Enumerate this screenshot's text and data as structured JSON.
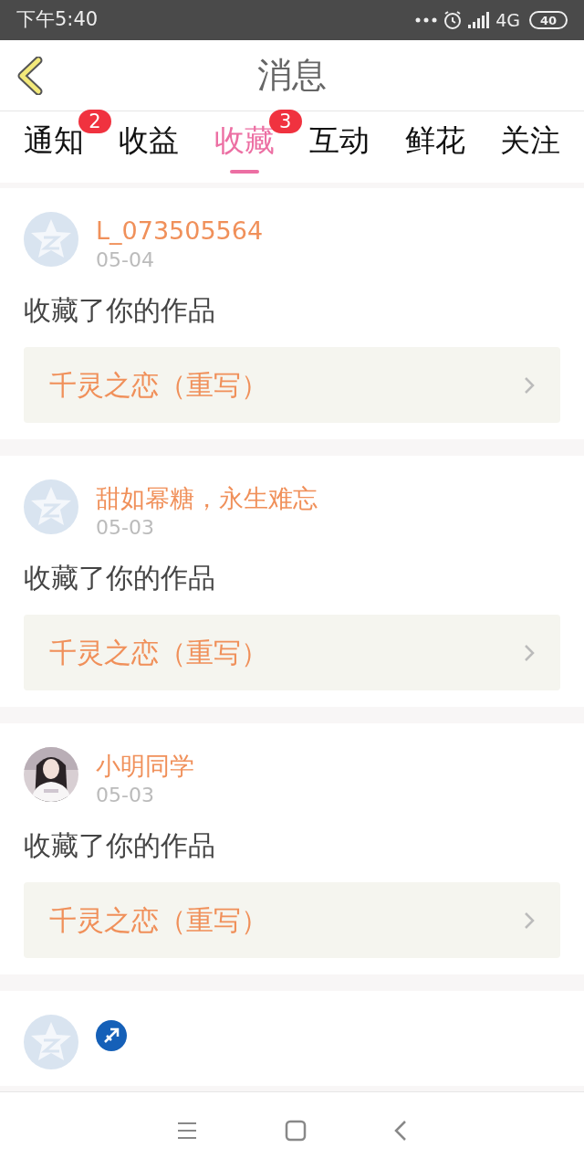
{
  "status_bar": {
    "time": "下午5:40",
    "network": "4G",
    "battery": "40"
  },
  "header": {
    "title": "消息"
  },
  "tabs": [
    {
      "label": "通知",
      "selected": false,
      "badge": "2"
    },
    {
      "label": "收益",
      "selected": false
    },
    {
      "label": "收藏",
      "selected": true,
      "badge": "3"
    },
    {
      "label": "互动",
      "selected": false
    },
    {
      "label": "鲜花",
      "selected": false
    },
    {
      "label": "关注",
      "selected": false
    }
  ],
  "messages": [
    {
      "kind": "default",
      "name": "L_073505564",
      "date": "05-04",
      "text": "收藏了你的作品",
      "work": "千灵之恋（重写）"
    },
    {
      "kind": "default",
      "name": "甜如幂糖，永生难忘",
      "date": "05-03",
      "text": "收藏了你的作品",
      "work": "千灵之恋（重写）"
    },
    {
      "kind": "picture",
      "name": "小明同学",
      "date": "05-03",
      "text": "收藏了你的作品",
      "work": "千灵之恋（重写）"
    },
    {
      "kind": "default",
      "zodiac": true
    }
  ]
}
